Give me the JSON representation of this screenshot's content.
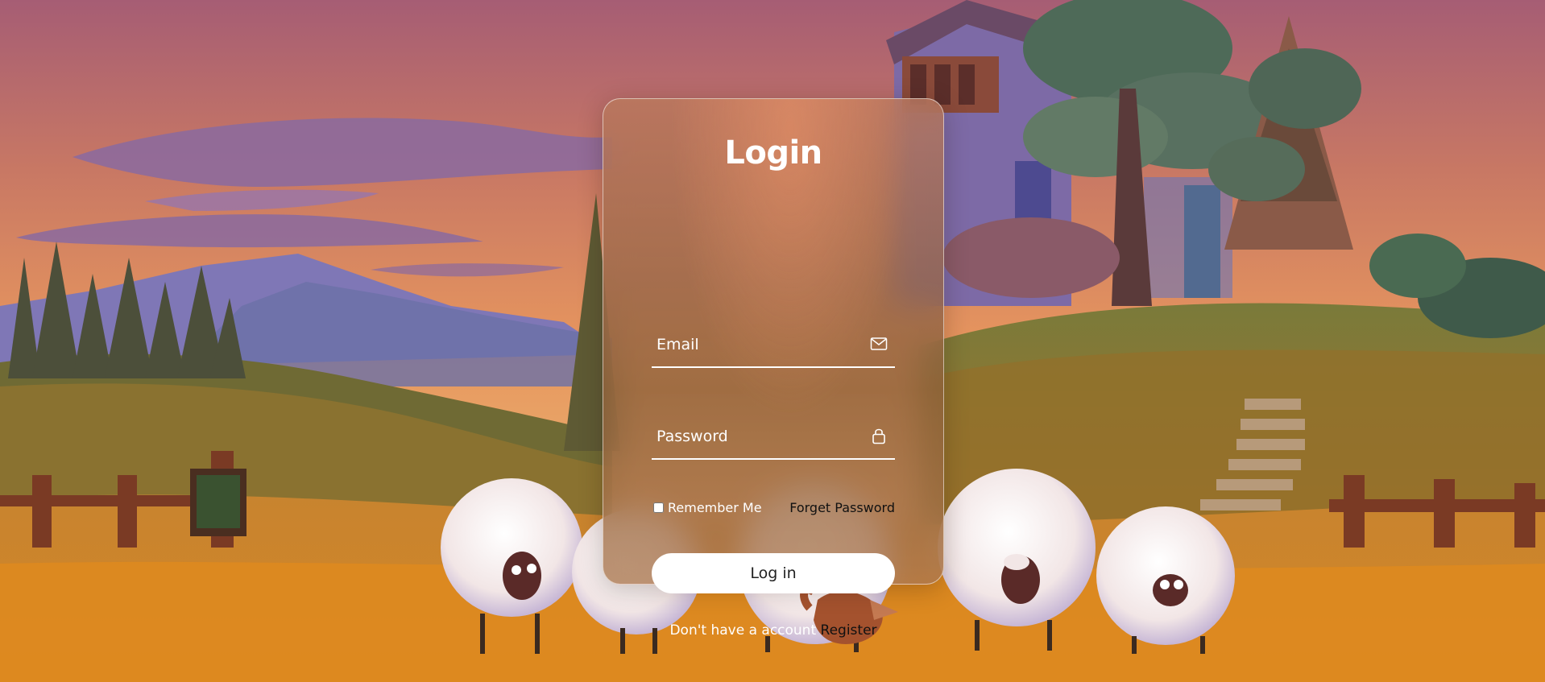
{
  "login": {
    "title": "Login",
    "email": {
      "placeholder": "Email",
      "value": "",
      "icon": "envelope-icon"
    },
    "password": {
      "placeholder": "Password",
      "value": "",
      "icon": "lock-icon"
    },
    "remember_label": "Remember Me",
    "remember_checked": false,
    "forget_label": "Forget Password",
    "submit_label": "Log in",
    "register_prompt": "Don't have a account",
    "register_label": "Register"
  },
  "colors": {
    "card_text": "#ffffff",
    "link_text": "#111111",
    "button_bg": "#ffffff",
    "sky_top": "#b46a78",
    "sky_mid": "#e6955e"
  },
  "background": {
    "scene": "illustration-sunset-hillside-sheep-house"
  }
}
